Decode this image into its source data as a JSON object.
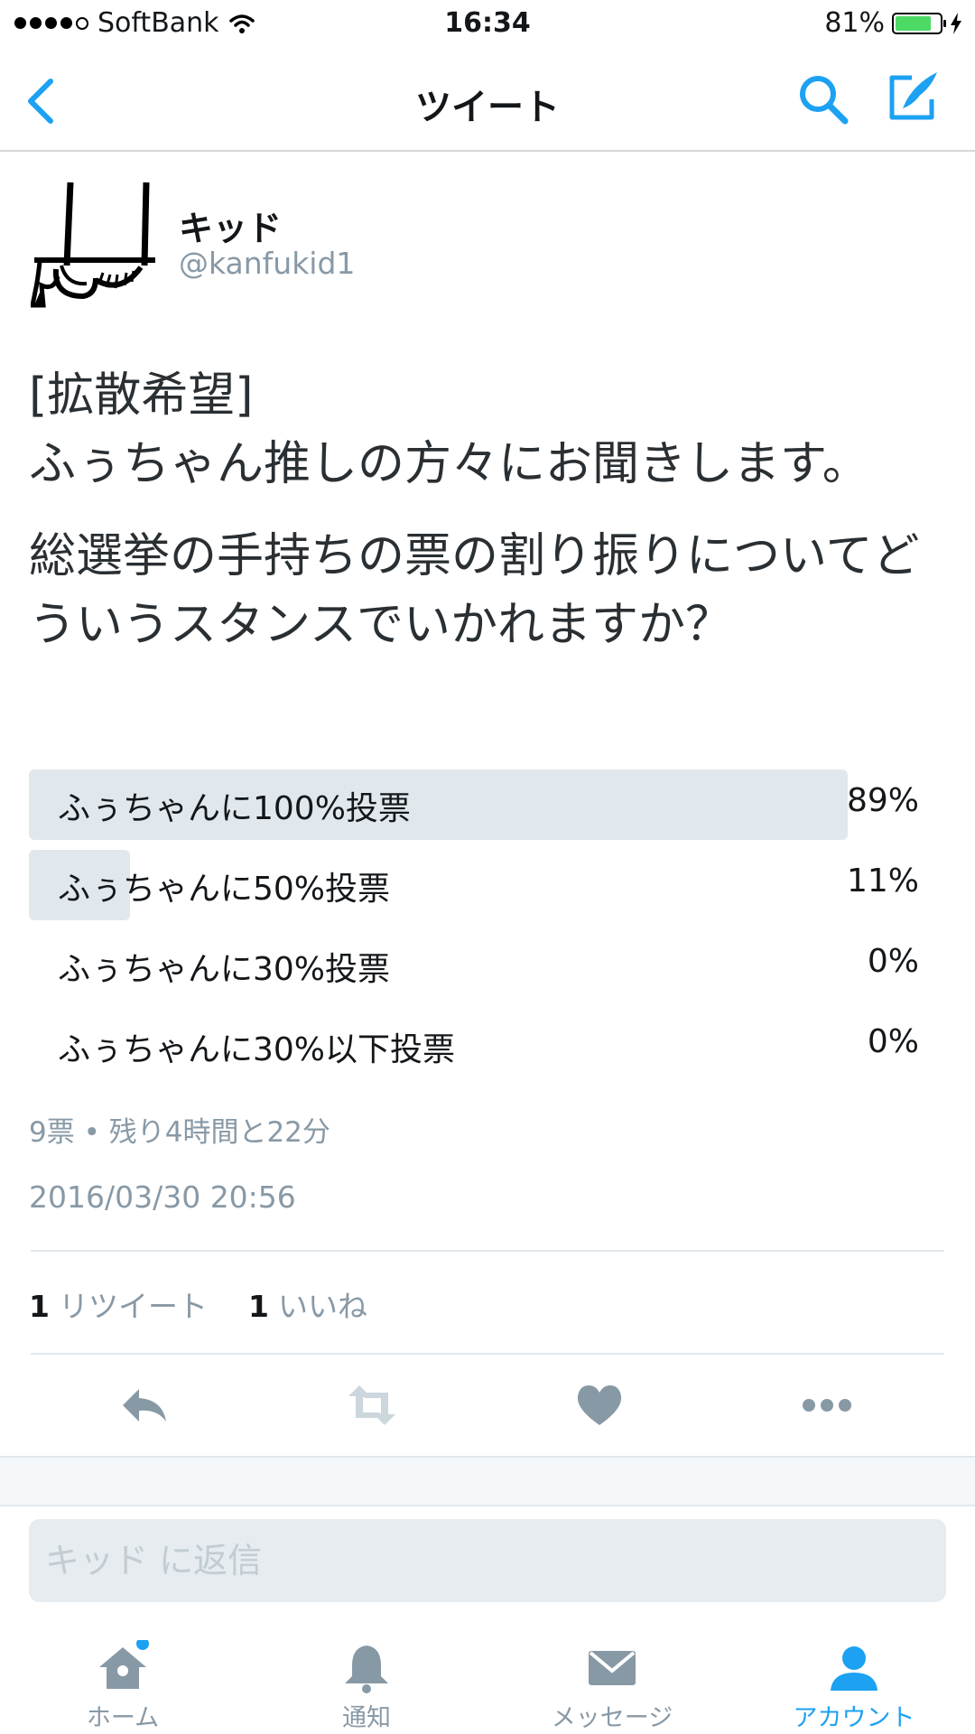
{
  "status_bar": {
    "carrier": "SoftBank",
    "time": "16:34",
    "battery": "81%",
    "battery_level": 0.81
  },
  "nav": {
    "title": "ツイート",
    "back_icon": "chevron-left-icon",
    "search_icon": "search-icon",
    "compose_icon": "compose-icon"
  },
  "author": {
    "name": "キッド",
    "handle": "@kanfukid1"
  },
  "tweet": {
    "line1": "[拡散希望]",
    "line2": "ふぅちゃん推しの方々にお聞きします。",
    "line3": "総選挙の手持ちの票の割り振りについてどういうスタンスでいかれますか？"
  },
  "poll": {
    "options": [
      {
        "label": "ふぅちゃんに100%投票",
        "percent": "89%",
        "fraction": 0.89
      },
      {
        "label": "ふぅちゃんに50%投票",
        "percent": "11%",
        "fraction": 0.11
      },
      {
        "label": "ふぅちゃんに30%投票",
        "percent": "0%",
        "fraction": 0
      },
      {
        "label": "ふぅちゃんに30%以下投票",
        "percent": "0%",
        "fraction": 0
      }
    ],
    "meta": "9票 • 残り4時間と22分"
  },
  "timestamp": "2016/03/30 20:56",
  "stats": {
    "retweets_count": "1",
    "retweets_label": "リツイート",
    "likes_count": "1",
    "likes_label": "いいね"
  },
  "actions": [
    "reply-icon",
    "retweet-icon",
    "heart-icon",
    "more-icon"
  ],
  "reply": {
    "placeholder": "キッド に返信"
  },
  "tabs": [
    {
      "label": "ホーム",
      "icon": "home-icon"
    },
    {
      "label": "通知",
      "icon": "bell-icon"
    },
    {
      "label": "メッセージ",
      "icon": "envelope-icon"
    },
    {
      "label": "アカウント",
      "icon": "person-icon"
    }
  ],
  "colors": {
    "accent": "#1da1f2",
    "icon_gray": "#8899a6",
    "poll_bar": "#e1e8ed",
    "battery": "#4cd964"
  }
}
